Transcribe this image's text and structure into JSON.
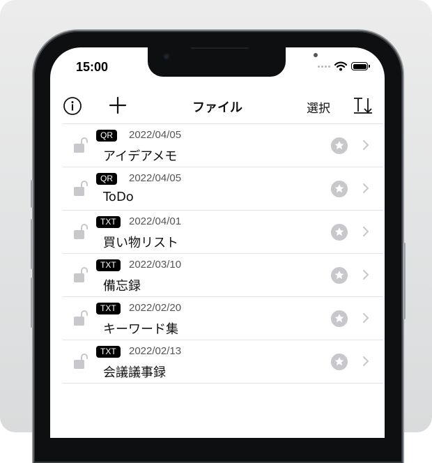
{
  "status_bar": {
    "time": "15:00"
  },
  "nav": {
    "title": "ファイル",
    "select_label": "選択"
  },
  "files": [
    {
      "type": "QR",
      "date": "2022/04/05",
      "name": "アイデアメモ"
    },
    {
      "type": "QR",
      "date": "2022/04/05",
      "name": "ToDo"
    },
    {
      "type": "TXT",
      "date": "2022/04/01",
      "name": "買い物リスト"
    },
    {
      "type": "TXT",
      "date": "2022/03/10",
      "name": "備忘録"
    },
    {
      "type": "TXT",
      "date": "2022/02/20",
      "name": "キーワード集"
    },
    {
      "type": "TXT",
      "date": "2022/02/13",
      "name": "会議議事録"
    }
  ],
  "icons": [
    "info-icon",
    "plus-icon",
    "sort-icon",
    "lock-open-icon",
    "star-icon",
    "chevron-right-icon",
    "wifi-icon",
    "battery-icon"
  ],
  "colors": {
    "badge_bg": "#000000",
    "icon_gray": "#c7c7cc",
    "separator": "#e4e4e6"
  }
}
